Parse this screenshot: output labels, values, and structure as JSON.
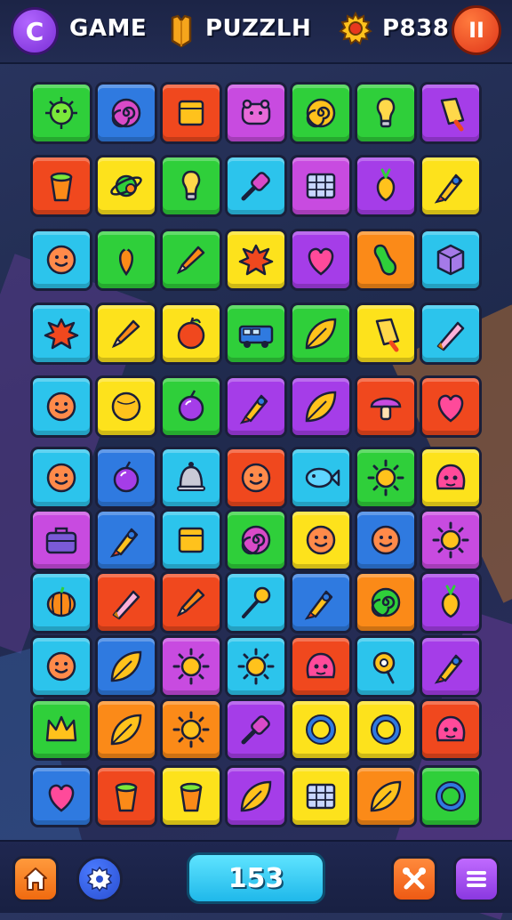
{
  "header": {
    "menu_icon": "C",
    "game_label": "GAME",
    "puzzle_label": "PUZZLH",
    "score_label": "P838",
    "pause_icon": "II"
  },
  "footer": {
    "move_count": "153"
  },
  "colors": {
    "green": "#2fcf3a",
    "blue": "#2f7ae0",
    "red": "#f0481e",
    "purple": "#a53de8",
    "yellow": "#fde21c",
    "cyan": "#2cc4ec",
    "orange": "#fb8a18",
    "magenta": "#c84be0"
  },
  "board": {
    "rows": [
      [
        {
          "color": "#2fcf3a",
          "icon": "germ"
        },
        {
          "color": "#2f7ae0",
          "icon": "spiral-flower"
        },
        {
          "color": "#f0481e",
          "icon": "box"
        },
        {
          "color": "#c84be0",
          "icon": "bear"
        },
        {
          "color": "#2fcf3a",
          "icon": "snail-shell"
        },
        {
          "color": "#2fcf3a",
          "icon": "bulb"
        },
        {
          "color": "#a53de8",
          "icon": "popsicle"
        }
      ],
      [
        {
          "color": "#f0481e",
          "icon": "cup"
        },
        {
          "color": "#fde21c",
          "icon": "planet"
        },
        {
          "color": "#2fcf3a",
          "icon": "bulb"
        },
        {
          "color": "#2cc4ec",
          "icon": "brush"
        },
        {
          "color": "#c84be0",
          "icon": "grid"
        },
        {
          "color": "#a53de8",
          "icon": "turnip"
        },
        {
          "color": "#fde21c",
          "icon": "rocket"
        }
      ],
      [
        {
          "color": "#2cc4ec",
          "icon": "smiley"
        },
        {
          "color": "#2fcf3a",
          "icon": "carrot"
        },
        {
          "color": "#2fcf3a",
          "icon": "pencil"
        },
        {
          "color": "#fde21c",
          "icon": "splat"
        },
        {
          "color": "#a53de8",
          "icon": "heart"
        },
        {
          "color": "#fb8a18",
          "icon": "gourd"
        },
        {
          "color": "#2cc4ec",
          "icon": "cube"
        }
      ],
      [
        {
          "color": "#2cc4ec",
          "icon": "splat"
        },
        {
          "color": "#fde21c",
          "icon": "pencil"
        },
        {
          "color": "#fde21c",
          "icon": "apple"
        },
        {
          "color": "#2fcf3a",
          "icon": "truck"
        },
        {
          "color": "#2fcf3a",
          "icon": "leaf"
        },
        {
          "color": "#fde21c",
          "icon": "popsicle"
        },
        {
          "color": "#2cc4ec",
          "icon": "crayon"
        }
      ],
      [
        {
          "color": "#2cc4ec",
          "icon": "smiley"
        },
        {
          "color": "#fde21c",
          "icon": "ball"
        },
        {
          "color": "#2fcf3a",
          "icon": "fruit"
        },
        {
          "color": "#a53de8",
          "icon": "rocket"
        },
        {
          "color": "#a53de8",
          "icon": "leaf"
        },
        {
          "color": "#f0481e",
          "icon": "mushroom"
        },
        {
          "color": "#f0481e",
          "icon": "heart"
        }
      ],
      [
        {
          "color": "#2cc4ec",
          "icon": "smiley"
        },
        {
          "color": "#2f7ae0",
          "icon": "fruit"
        },
        {
          "color": "#2cc4ec",
          "icon": "bell"
        },
        {
          "color": "#f0481e",
          "icon": "smiley"
        },
        {
          "color": "#2cc4ec",
          "icon": "fish"
        },
        {
          "color": "#2fcf3a",
          "icon": "sun"
        },
        {
          "color": "#fde21c",
          "icon": "monster"
        }
      ],
      [
        {
          "color": "#c84be0",
          "icon": "suitcase"
        },
        {
          "color": "#2f7ae0",
          "icon": "rocket"
        },
        {
          "color": "#2cc4ec",
          "icon": "box"
        },
        {
          "color": "#2fcf3a",
          "icon": "spiral-flower"
        },
        {
          "color": "#fde21c",
          "icon": "smiley"
        },
        {
          "color": "#2f7ae0",
          "icon": "smiley"
        },
        {
          "color": "#c84be0",
          "icon": "sun"
        }
      ],
      [
        {
          "color": "#2cc4ec",
          "icon": "pumpkin"
        },
        {
          "color": "#f0481e",
          "icon": "crayon"
        },
        {
          "color": "#f0481e",
          "icon": "pencil"
        },
        {
          "color": "#2cc4ec",
          "icon": "wand"
        },
        {
          "color": "#2f7ae0",
          "icon": "rocket"
        },
        {
          "color": "#fb8a18",
          "icon": "spiral"
        },
        {
          "color": "#a53de8",
          "icon": "turnip"
        }
      ],
      [
        {
          "color": "#2cc4ec",
          "icon": "smiley"
        },
        {
          "color": "#2f7ae0",
          "icon": "leaf"
        },
        {
          "color": "#c84be0",
          "icon": "sun"
        },
        {
          "color": "#2cc4ec",
          "icon": "sun"
        },
        {
          "color": "#f0481e",
          "icon": "monster"
        },
        {
          "color": "#2cc4ec",
          "icon": "pin"
        },
        {
          "color": "#a53de8",
          "icon": "rocket"
        }
      ],
      [
        {
          "color": "#2fcf3a",
          "icon": "crown"
        },
        {
          "color": "#fb8a18",
          "icon": "leaf"
        },
        {
          "color": "#fb8a18",
          "icon": "sun"
        },
        {
          "color": "#a53de8",
          "icon": "brush"
        },
        {
          "color": "#fde21c",
          "icon": "ring"
        },
        {
          "color": "#fde21c",
          "icon": "ring"
        },
        {
          "color": "#f0481e",
          "icon": "monster"
        }
      ],
      [
        {
          "color": "#2f7ae0",
          "icon": "heart"
        },
        {
          "color": "#f0481e",
          "icon": "cup"
        },
        {
          "color": "#fde21c",
          "icon": "cup"
        },
        {
          "color": "#a53de8",
          "icon": "leaf"
        },
        {
          "color": "#fde21c",
          "icon": "grid"
        },
        {
          "color": "#fb8a18",
          "icon": "leaf"
        },
        {
          "color": "#2fcf3a",
          "icon": "ring"
        }
      ]
    ]
  }
}
